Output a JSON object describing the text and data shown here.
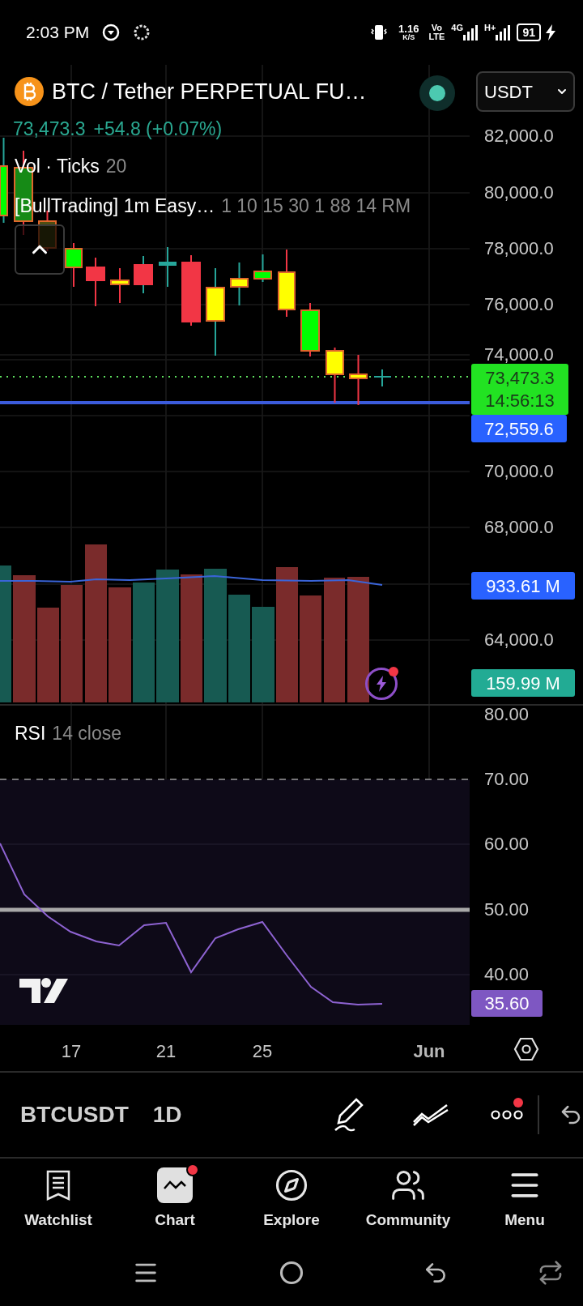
{
  "status_bar": {
    "time": "2:03 PM",
    "speed_value": "1.16",
    "speed_unit": "K/S",
    "volte_top": "Vo",
    "volte_bottom": "LTE",
    "network_1": "4G",
    "network_2": "H+",
    "battery": "91"
  },
  "header": {
    "title": "BTC / Tether PERPETUAL FU…",
    "market_open": true,
    "currency": "USDT",
    "last_price": "73,473.3",
    "change": "+54.8 (+0.07%)"
  },
  "legend": [
    {
      "name": "Vol · Ticks",
      "params": "20"
    },
    {
      "name": "[BullTrading] 1m Easy…",
      "params": "1 10 15 30 1 88 14 RM"
    }
  ],
  "price_axis": [
    "82,000.0",
    "80,000.0",
    "78,000.0",
    "76,000.0",
    "74,000.0",
    "70,000.0",
    "68,000.0",
    "64,000.0"
  ],
  "price_tags": [
    {
      "kind": "last",
      "value": "73,473.3",
      "countdown": "14:56:13",
      "color": "#22e222"
    },
    {
      "kind": "line",
      "value": "72,559.6",
      "color": "#2962ff"
    },
    {
      "kind": "volume",
      "value": "933.61 M",
      "color": "#2962ff"
    },
    {
      "kind": "volume",
      "value": "159.99 M",
      "color": "#22ab94"
    }
  ],
  "rsi": {
    "name": "RSI",
    "params": "14 close",
    "axis": [
      "80.00",
      "70.00",
      "60.00",
      "50.00",
      "40.00"
    ],
    "tag": "35.60"
  },
  "time_axis": [
    {
      "label": "17",
      "kind": "day"
    },
    {
      "label": "21",
      "kind": "day"
    },
    {
      "label": "25",
      "kind": "day"
    },
    {
      "label": "Jun",
      "kind": "month"
    }
  ],
  "toolbar": {
    "symbol": "BTCUSDT",
    "interval": "1D",
    "more_badge": true
  },
  "nav": [
    {
      "label": "Watchlist",
      "selected": false,
      "badge": false
    },
    {
      "label": "Chart",
      "selected": true,
      "badge": true
    },
    {
      "label": "Explore",
      "selected": false,
      "badge": false
    },
    {
      "label": "Community",
      "selected": false,
      "badge": false
    },
    {
      "label": "Menu",
      "selected": false,
      "badge": false
    }
  ]
}
